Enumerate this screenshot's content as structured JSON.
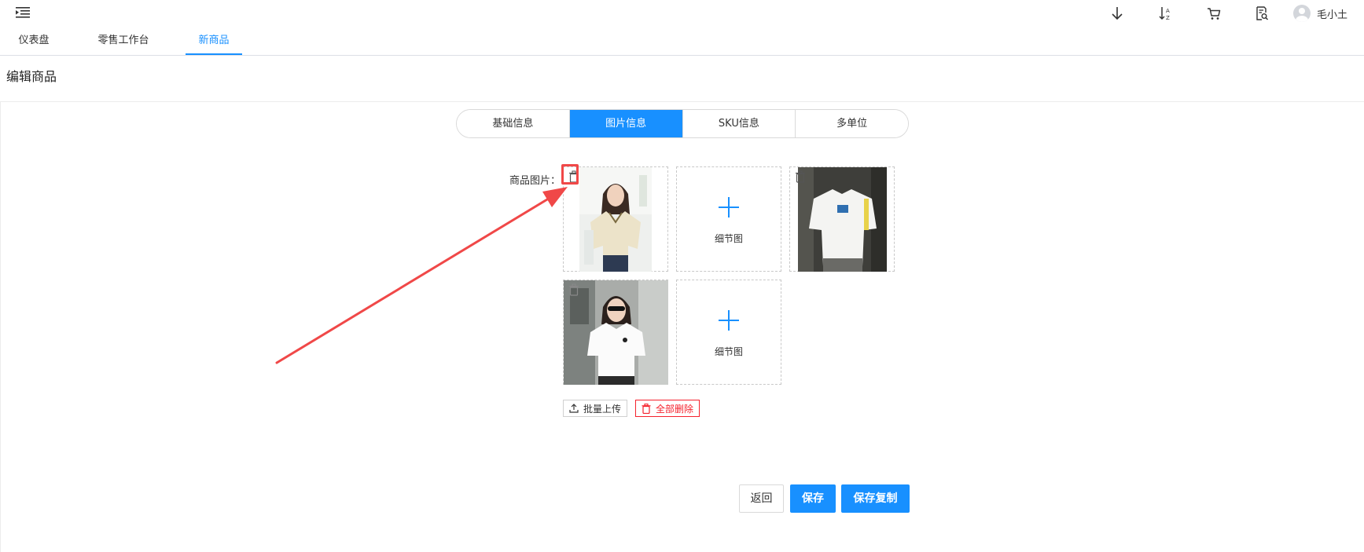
{
  "header": {
    "user_name": "毛小土",
    "icons": [
      "menu-fold-icon",
      "download-icon",
      "sort-az-icon",
      "cart-icon",
      "document-search-icon"
    ]
  },
  "tabs": [
    {
      "label": "仪表盘",
      "active": false
    },
    {
      "label": "零售工作台",
      "active": false
    },
    {
      "label": "新商品",
      "active": true
    }
  ],
  "page": {
    "title": "编辑商品"
  },
  "segments": [
    {
      "label": "基础信息",
      "active": false
    },
    {
      "label": "图片信息",
      "active": true
    },
    {
      "label": "SKU信息",
      "active": false
    },
    {
      "label": "多单位",
      "active": false
    }
  ],
  "images": {
    "label": "商品图片：",
    "add_detail_label": "细节图",
    "batch_upload_label": "批量上传",
    "delete_all_label": "全部删除"
  },
  "actions": {
    "back_label": "返回",
    "save_label": "保存",
    "save_copy_label": "保存复制"
  },
  "colors": {
    "primary": "#1890ff",
    "danger": "#f5222d",
    "annotation": "#f04848"
  }
}
